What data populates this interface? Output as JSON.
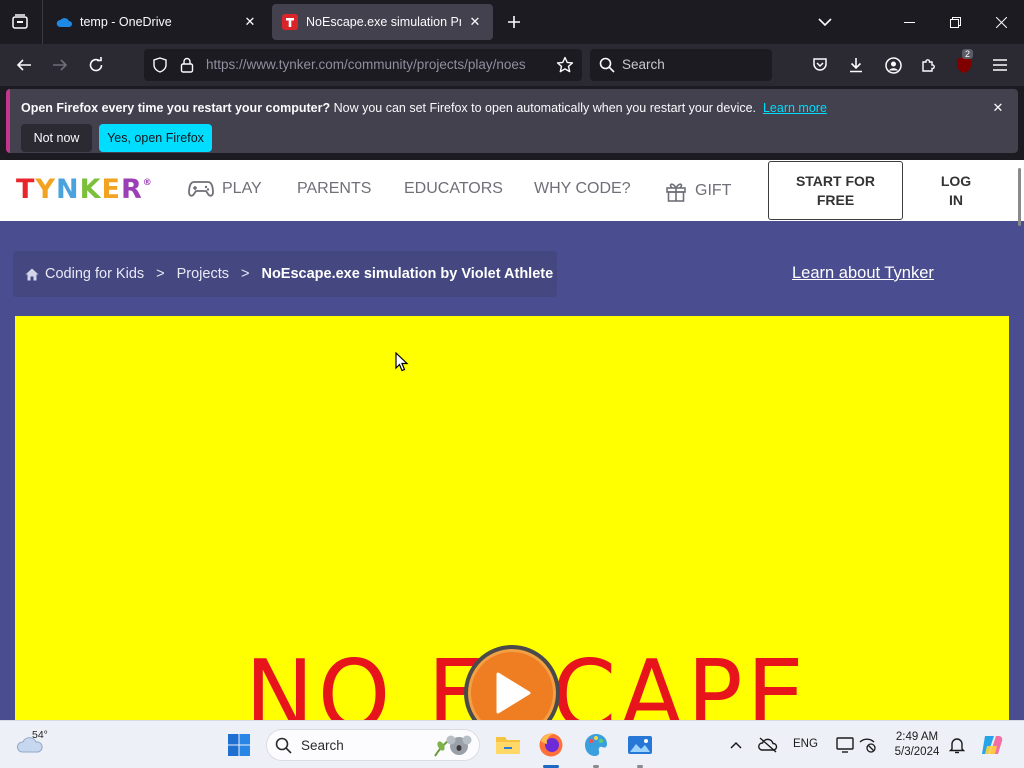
{
  "browser": {
    "tabs": [
      {
        "title": "temp - OneDrive",
        "active": false
      },
      {
        "title": "NoEscape.exe simulation Projec",
        "active": true
      }
    ],
    "url": "https://www.tynker.com/community/projects/play/noes",
    "search_placeholder": "Search",
    "extensions_badge": "2"
  },
  "notification": {
    "bold_text": "Open Firefox every time you restart your computer?",
    "text": " Now you can set Firefox to open automatically when you restart your device.",
    "link": "Learn more",
    "not_now": "Not now",
    "yes": "Yes, open Firefox"
  },
  "site": {
    "logo": "TYNKER",
    "nav": {
      "play": "PLAY",
      "parents": "PARENTS",
      "educators": "EDUCATORS",
      "why_code": "WHY CODE?",
      "gift": "GIFT"
    },
    "start_line1": "START FOR",
    "start_line2": "FREE",
    "login_line1": "LOG",
    "login_line2": "IN",
    "breadcrumbs": {
      "home": "Coding for Kids",
      "sep": ">",
      "projects": "Projects",
      "current": "NoEscape.exe simulation by Violet Athlete"
    },
    "learn_about": "Learn about Tynker",
    "stage_text": "NO ESCAPE",
    "stage_color": "#ffff00",
    "background_color": "#4b4d91"
  },
  "taskbar": {
    "weather_temp": "54°",
    "search_label": "Search",
    "language": "ENG",
    "time": "2:49 AM",
    "date": "5/3/2024"
  }
}
